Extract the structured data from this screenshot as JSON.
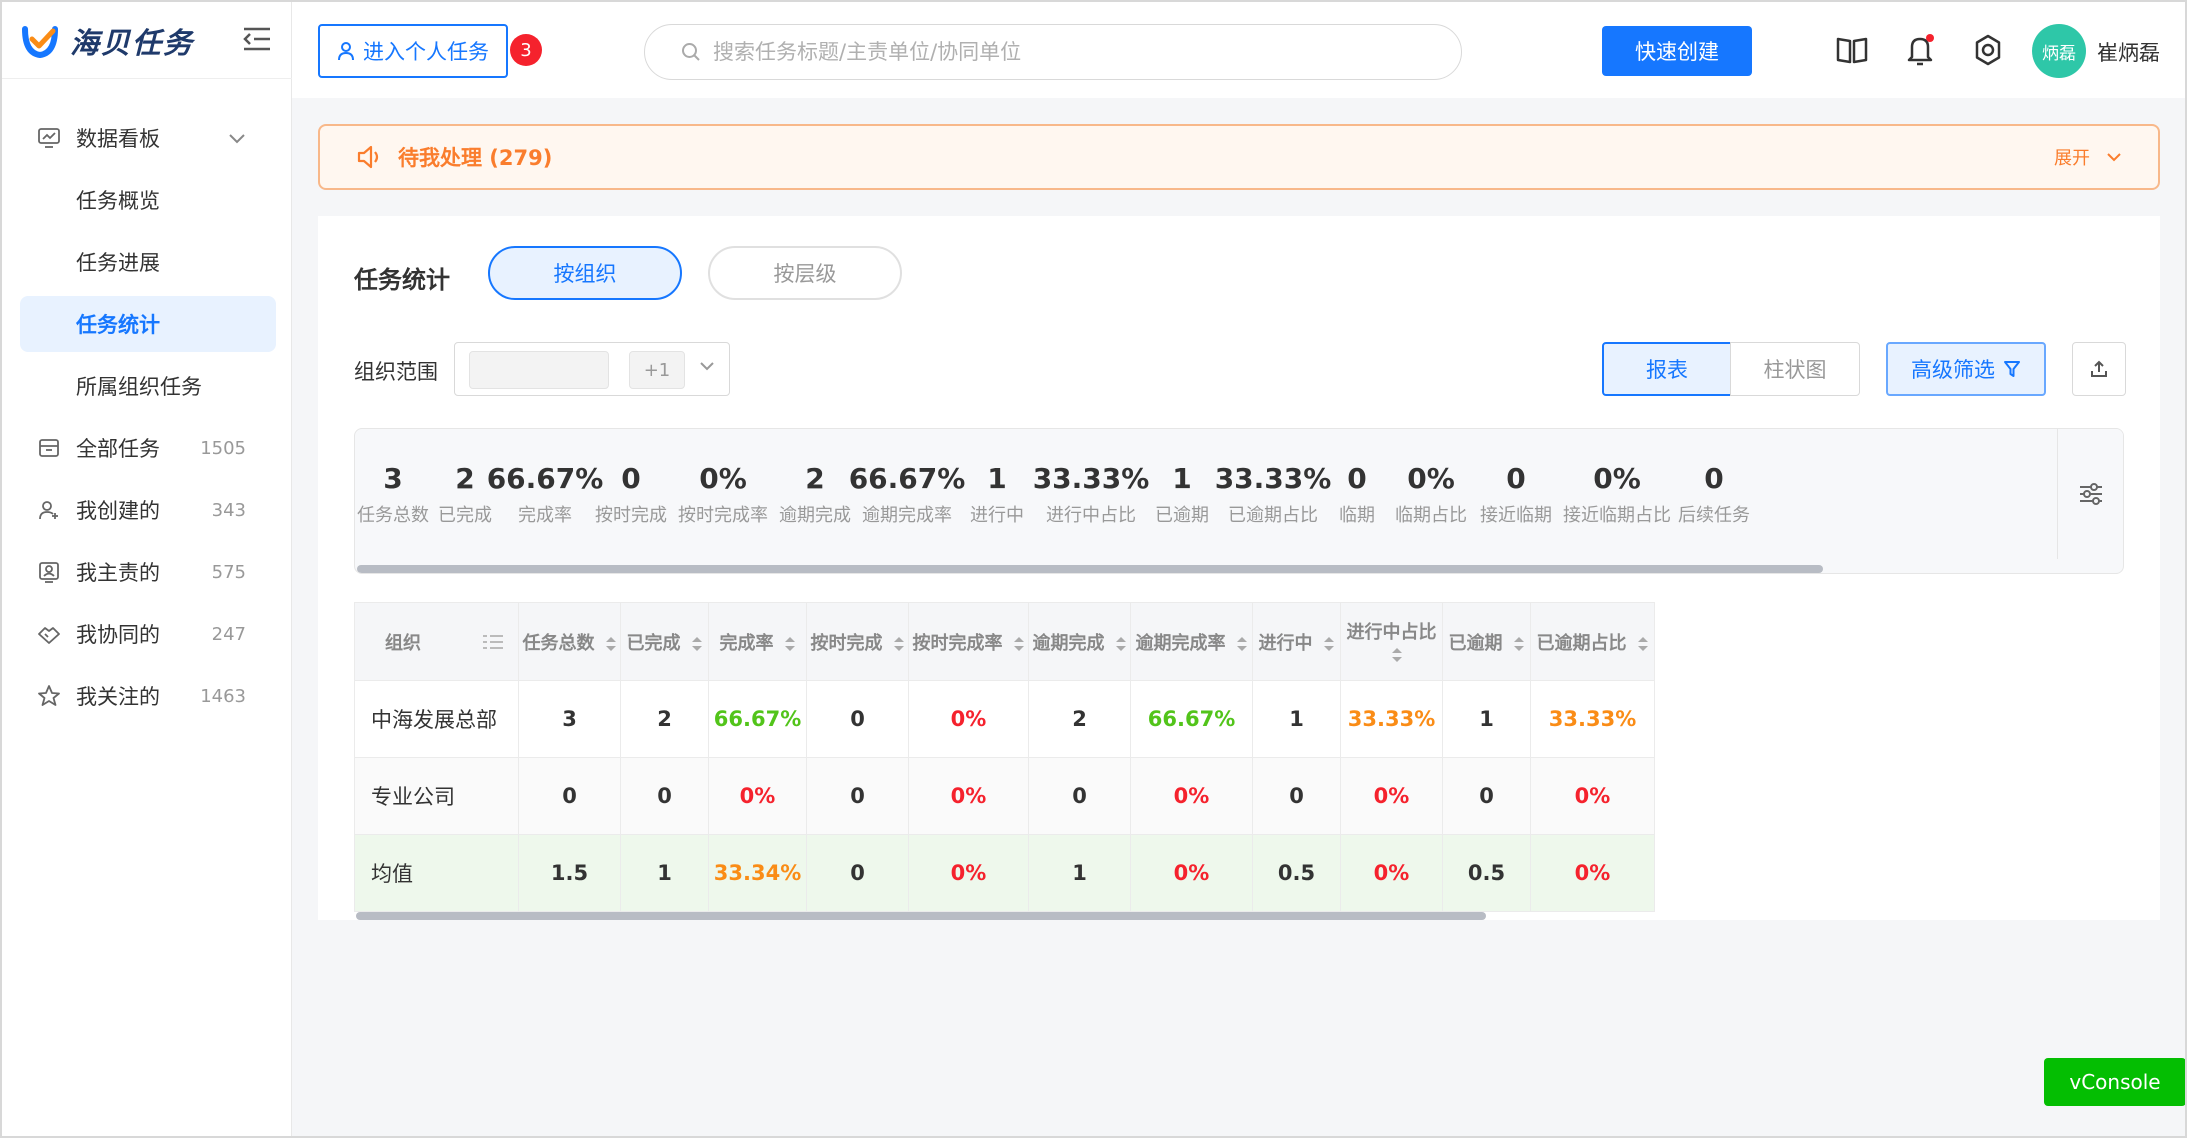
{
  "app": {
    "title": "海贝任务"
  },
  "header": {
    "personal_btn": "进入个人任务",
    "badge": "3",
    "search_placeholder": "搜索任务标题/主责单位/协同单位",
    "quick_create": "快速创建",
    "avatar_text": "炳磊",
    "user_name": "崔炳磊"
  },
  "sidebar": {
    "items": [
      {
        "label": "数据看板",
        "icon": "dashboard-icon"
      },
      {
        "label": "任务概览"
      },
      {
        "label": "任务进展"
      },
      {
        "label": "任务统计"
      },
      {
        "label": "所属组织任务"
      },
      {
        "label": "全部任务",
        "count": "1505",
        "icon": "folder-icon"
      },
      {
        "label": "我创建的",
        "count": "343",
        "icon": "user-add-icon"
      },
      {
        "label": "我主责的",
        "count": "575",
        "icon": "badge-icon"
      },
      {
        "label": "我协同的",
        "count": "247",
        "icon": "handshake-icon"
      },
      {
        "label": "我关注的",
        "count": "1463",
        "icon": "star-icon"
      }
    ]
  },
  "pending": {
    "label": "待我处理 (279)",
    "expand": "展开"
  },
  "stats": {
    "title": "任务统计",
    "seg_org": "按组织",
    "seg_level": "按层级",
    "org_label": "组织范围",
    "org_plus": "+1",
    "view_report": "报表",
    "view_bar": "柱状图",
    "adv_filter": "高级筛选"
  },
  "summary": [
    {
      "value": "3",
      "label": "任务总数"
    },
    {
      "value": "2",
      "label": "已完成"
    },
    {
      "value": "66.67%",
      "label": "完成率"
    },
    {
      "value": "0",
      "label": "按时完成"
    },
    {
      "value": "0%",
      "label": "按时完成率"
    },
    {
      "value": "2",
      "label": "逾期完成"
    },
    {
      "value": "66.67%",
      "label": "逾期完成率"
    },
    {
      "value": "1",
      "label": "进行中"
    },
    {
      "value": "33.33%",
      "label": "进行中占比"
    },
    {
      "value": "1",
      "label": "已逾期"
    },
    {
      "value": "33.33%",
      "label": "已逾期占比"
    },
    {
      "value": "0",
      "label": "临期"
    },
    {
      "value": "0%",
      "label": "临期占比"
    },
    {
      "value": "0",
      "label": "接近临期"
    },
    {
      "value": "0%",
      "label": "接近临期占比"
    },
    {
      "value": "0",
      "label": "后续任务"
    }
  ],
  "table": {
    "columns": [
      "组织",
      "任务总数",
      "已完成",
      "完成率",
      "按时完成",
      "按时完成率",
      "逾期完成",
      "逾期完成率",
      "进行中",
      "进行中占比",
      "已逾期",
      "已逾期占比"
    ],
    "rows": [
      {
        "cells": [
          "中海发展总部",
          "3",
          "2",
          "66.67%",
          "0",
          "0%",
          "2",
          "66.67%",
          "1",
          "33.33%",
          "1",
          "33.33%"
        ]
      },
      {
        "cells": [
          "专业公司",
          "0",
          "0",
          "0%",
          "0",
          "0%",
          "0",
          "0%",
          "0",
          "0%",
          "0",
          "0%"
        ]
      },
      {
        "cells": [
          "均值",
          "1.5",
          "1",
          "33.34%",
          "0",
          "0%",
          "1",
          "0%",
          "0.5",
          "0%",
          "0.5",
          "0%"
        ]
      }
    ]
  },
  "vconsole": "vConsole",
  "colors": {
    "accent": "#1677ff",
    "green": "#52c41a",
    "red": "#f5222d",
    "orange": "#fa8c16",
    "pending": "#fa7d2d"
  }
}
